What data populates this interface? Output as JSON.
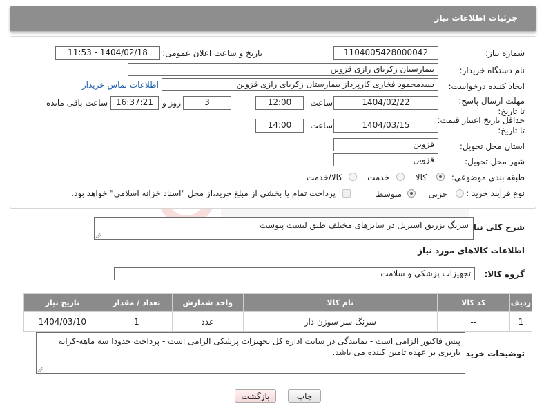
{
  "header": {
    "title": "جزئیات اطلاعات نیاز"
  },
  "form": {
    "need_number_label": "شماره نیاز:",
    "need_number": "1104005428000042",
    "announce_label": "تاریخ و ساعت اعلان عمومی:",
    "announce_value": "1404/02/18 - 11:53",
    "buyer_org_label": "نام دستگاه خریدار:",
    "buyer_org": "بیمارستان زکریای رازی قزوین",
    "creator_label": "ایجاد کننده درخواست:",
    "creator": "سیدمحمود فخاری کارپرداز بیمارستان زکریای رازی قزوین",
    "buyer_contact_link": "اطلاعات تماس خریدار",
    "reply_deadline_label": "مهلت ارسال پاسخ: تا تاریخ:",
    "reply_date": "1404/02/22",
    "time_label": "ساعت",
    "reply_time": "12:00",
    "days_value": "3",
    "days_label": "روز و",
    "remaining_time": "16:37:21",
    "remaining_label": "ساعت باقی مانده",
    "price_validity_label": "حداقل تاریخ اعتبار قیمت: تا تاریخ:",
    "validity_date": "1404/03/15",
    "validity_time": "14:00",
    "province_label": "استان محل تحویل:",
    "province": "قزوین",
    "city_label": "شهر محل تحویل:",
    "city": "قزوین",
    "category_label": "طبقه بندی موضوعی:",
    "category_options": [
      "کالا",
      "خدمت",
      "کالا/خدمت"
    ],
    "process_label": "نوع فرآیند خرید :",
    "process_options": [
      "جزیی",
      "متوسط"
    ],
    "payment_note": "پرداخت تمام یا بخشی از مبلغ خرید،از محل \"اسناد خزانه اسلامی\" خواهد بود."
  },
  "description": {
    "label": "شرح کلی نیاز:",
    "value": "سرنگ تزریق استریل در سایزهای مختلف طبق لیست پیوست"
  },
  "goods_section": {
    "title": "اطلاعات کالاهای مورد نیاز"
  },
  "goods_group": {
    "label": "گروه کالا:",
    "value": "تجهیزات پزشکی و سلامت"
  },
  "table": {
    "headers": [
      "ردیف",
      "کد کالا",
      "نام کالا",
      "واحد شمارش",
      "تعداد / مقدار",
      "تاریخ نیاز"
    ],
    "rows": [
      [
        "1",
        "--",
        "سرنگ سر سوزن دار",
        "عدد",
        "1",
        "1404/03/10"
      ]
    ]
  },
  "buyer_notes": {
    "label": "توضیحات خریدار:",
    "value": "پیش فاکتور الزامی است - نمایندگی در سایت اداره کل تجهیزات پزشکی الزامی است - پرداخت حدودا سه ماهه-کرایه باربری بر عهده تامین کننده می باشد."
  },
  "buttons": {
    "print": "چاپ",
    "back": "بازگشت"
  },
  "colors": {
    "header_bg": "#8e8e8e",
    "table_header_bg": "#8b8b8b",
    "link": "#1f5fa8"
  }
}
